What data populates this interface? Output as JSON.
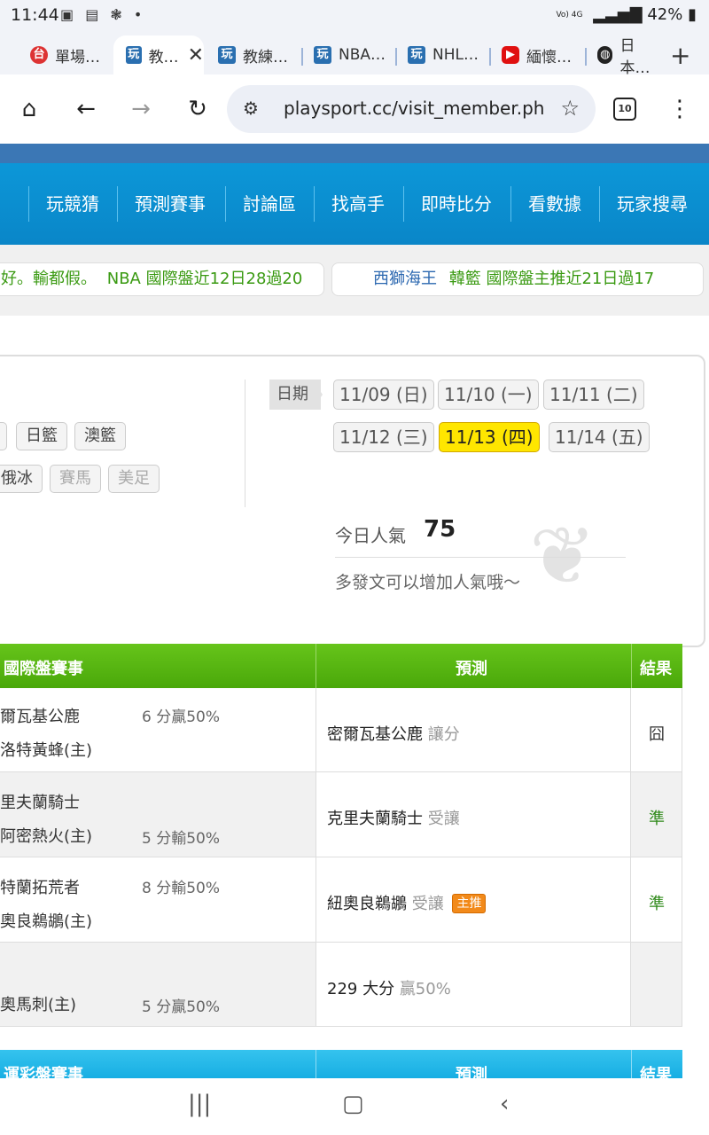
{
  "status_bar": {
    "time": "11:44",
    "left_icons": "▣ ▤ ❃ •",
    "battery": "42%",
    "signal": "Vo) 4G"
  },
  "tabs": [
    {
      "label": "單場…",
      "icon_color": "#d33"
    },
    {
      "label": "教…",
      "icon_color": "#2a6fb0"
    },
    {
      "label": "教練…",
      "icon_color": "#2a6fb0"
    },
    {
      "label": "NBA…",
      "icon_color": "#2a6fb0"
    },
    {
      "label": "NHL…",
      "icon_color": "#2a6fb0"
    },
    {
      "label": "緬懷…",
      "icon_color": "#e01010"
    },
    {
      "label": "日本…",
      "icon_color": "#222"
    }
  ],
  "toolbar": {
    "url": "playsport.cc/visit_member.ph",
    "tab_count": "10"
  },
  "nav": [
    "玩競猜",
    "預測賽事",
    "討論區",
    "找高手",
    "即時比分",
    "看數據",
    "玩家搜尋"
  ],
  "ticker": {
    "left_prefix": "好。輸都假。",
    "left_green": "NBA 國際盤近12日28過20",
    "right_blue": "西獅海王",
    "right_green": "韓籃 國際盤主推近21日過17"
  },
  "leagues_row1": [
    "日籃",
    "澳籃"
  ],
  "leagues_row2": [
    "俄冰",
    "賽馬",
    "美足"
  ],
  "date_label": "日期",
  "dates": [
    "11/09 (日)",
    "11/10 (一)",
    "11/11 (二)",
    "11/12 (三)",
    "11/13 (四)",
    "11/14 (五)"
  ],
  "selected_date": "11/13 (四)",
  "popularity": {
    "label": "今日人氣",
    "value": "75",
    "tip": "多發文可以增加人氣哦～"
  },
  "table_headers": {
    "games": "國際盤賽事",
    "prediction": "預測",
    "result": "結果"
  },
  "rows": [
    {
      "team1": "爾瓦基公鹿",
      "team2": "洛特黃蜂(主)",
      "spread1": "6 分贏50%",
      "spread2": "",
      "pred_main": "密爾瓦基公鹿",
      "pred_sub": "讓分",
      "badge": "",
      "result": "囧",
      "hit": false
    },
    {
      "team1": "里夫蘭騎士",
      "team2": "阿密熱火(主)",
      "spread1": "",
      "spread2": "5 分輸50%",
      "pred_main": "克里夫蘭騎士",
      "pred_sub": "受讓",
      "badge": "",
      "result": "準",
      "hit": true
    },
    {
      "team1": "特蘭拓荒者",
      "team2": "奧良鵜鶘(主)",
      "spread1": "8 分輸50%",
      "spread2": "",
      "pred_main": "紐奧良鵜鶘",
      "pred_sub": "受讓",
      "badge": "主推",
      "result": "準",
      "hit": true
    },
    {
      "team1": "",
      "team2": "奧馬刺(主)",
      "spread1": "",
      "spread2": "5 分贏50%",
      "pred_main": "229 大分",
      "pred_sub": "贏50%",
      "badge": "",
      "result": "",
      "hit": false
    }
  ],
  "table2_headers": {
    "games": "運彩盤賽事",
    "prediction": "預測",
    "result": "結果"
  },
  "colors": {
    "nav_blue": "#0c97d8",
    "header_green": "#5ab812",
    "selected_yellow": "#ffe600",
    "hit_green": "#2f8a1a"
  }
}
